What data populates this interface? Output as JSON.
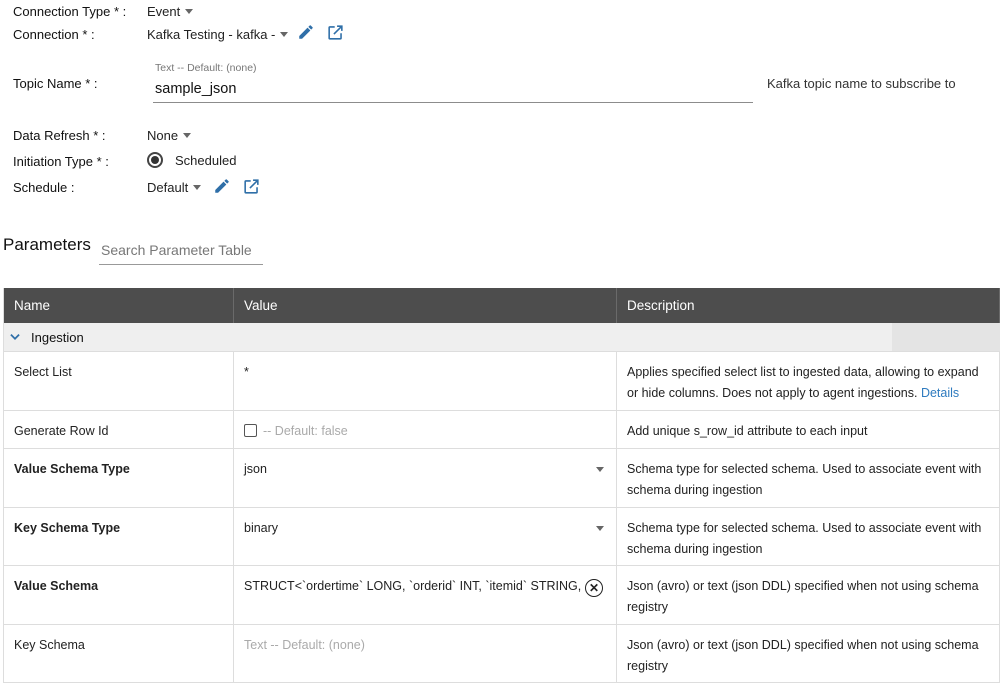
{
  "form": {
    "connection_type": {
      "label": "Connection Type * :",
      "value": "Event"
    },
    "connection": {
      "label": "Connection * :",
      "value": "Kafka Testing - kafka -"
    },
    "topic_name": {
      "label": "Topic Name * :",
      "hint": "Text -- Default: (none)",
      "value": "sample_json",
      "description": "Kafka topic name to subscribe to"
    },
    "data_refresh": {
      "label": "Data Refresh * :",
      "value": "None"
    },
    "initiation_type": {
      "label": "Initiation Type * :",
      "value": "Scheduled"
    },
    "schedule": {
      "label": "Schedule :",
      "value": "Default"
    }
  },
  "parameters": {
    "title": "Parameters",
    "search_placeholder": "Search Parameter Table",
    "columns": [
      "Name",
      "Value",
      "Description"
    ],
    "group": "Ingestion",
    "rows": [
      {
        "name": "Select List",
        "value": "*",
        "desc": "Applies specified select list to ingested data, allowing to expand or hide columns. Does not apply to agent ingestions.",
        "link": "Details"
      },
      {
        "name": "Generate Row Id",
        "value": "-- Default: false",
        "desc": "Add unique s_row_id attribute to each input"
      },
      {
        "name": "Value Schema Type",
        "value": "json",
        "desc": "Schema type for selected schema. Used to associate event with schema during ingestion"
      },
      {
        "name": "Key Schema Type",
        "value": "binary",
        "desc": "Schema type for selected schema. Used to associate event with schema during ingestion"
      },
      {
        "name": "Value Schema",
        "value": "STRUCT<`ordertime` LONG, `orderid` INT, `itemid` STRING, `or",
        "desc": "Json (avro) or text (json DDL) specified when not using schema registry"
      },
      {
        "name": "Key Schema",
        "value": "Text -- Default: (none)",
        "desc": "Json (avro) or text (json DDL) specified when not using schema registry"
      }
    ]
  },
  "colors": {
    "accent": "#2f7bbf",
    "header_bg": "#4d4d4d"
  }
}
